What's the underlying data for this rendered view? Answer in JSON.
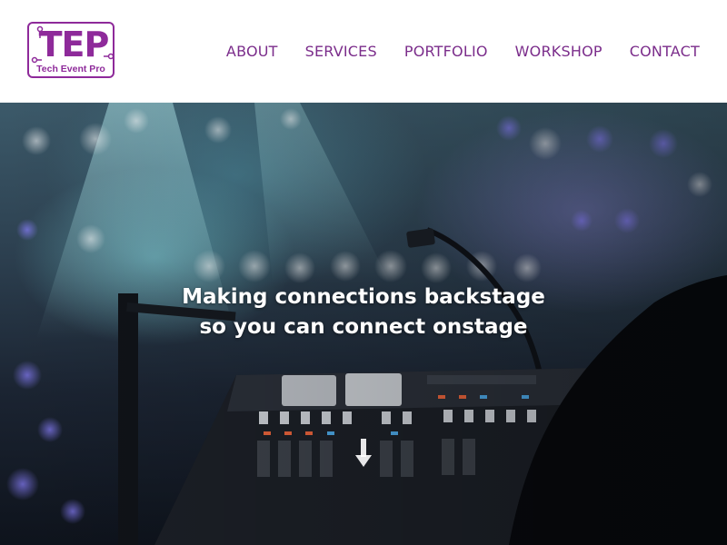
{
  "brand": {
    "logo_mark": "TEP",
    "logo_text": "Tech Event Pro",
    "accent_color": "#8e2a9a"
  },
  "nav": {
    "items": [
      {
        "label": "ABOUT"
      },
      {
        "label": "SERVICES"
      },
      {
        "label": "PORTFOLIO"
      },
      {
        "label": "WORKSHOP"
      },
      {
        "label": "CONTACT"
      }
    ]
  },
  "hero": {
    "headline_line1": "Making connections backstage",
    "headline_line2": "so you can connect onstage",
    "scroll_icon": "arrow-down-icon",
    "background_image": "audio-mixing-console-concert-lights"
  }
}
